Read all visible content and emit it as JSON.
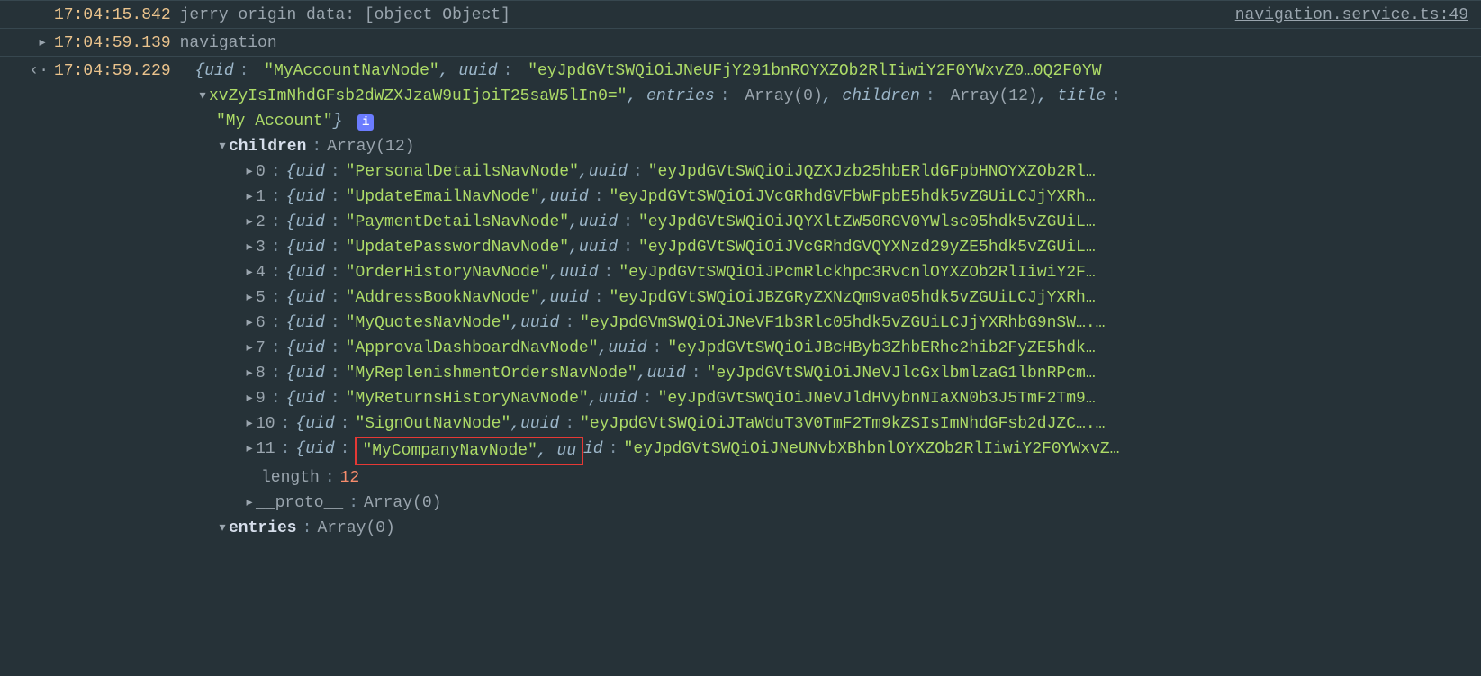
{
  "source_link": "navigation.service.ts:49",
  "log0": {
    "time": "17:04:15.842",
    "text": "jerry origin data:  [object Object]"
  },
  "log1": {
    "time": "17:04:59.139",
    "text": "navigation"
  },
  "log2": {
    "time": "17:04:59.229"
  },
  "obj": {
    "uid_key": "uid",
    "uid_val": "\"MyAccountNavNode\"",
    "uuid_key": "uuid",
    "uuid_val": "\"eyJpdGVtSWQiOiJNeUFjY291bnROYXZOb2RlIiwiY2F0YWxvZ0…0Q2F0YW",
    "uuid_val2": "xvZyIsImNhdGFsb2dWZXJzaW9uIjoiT25saW5lIn0=\"",
    "entries_key": "entries",
    "entries_val": "Array(0)",
    "children_key": "children",
    "children_val": "Array(12)",
    "title_key": "title",
    "title_val": "\"My Account\""
  },
  "children_header": {
    "label": "children",
    "type": "Array(12)"
  },
  "children": [
    {
      "idx": "0",
      "uid": "\"PersonalDetailsNavNode\"",
      "uuid": "\"eyJpdGVtSWQiOiJQZXJzb25hbERldGFpbHNOYXZOb2Rl…"
    },
    {
      "idx": "1",
      "uid": "\"UpdateEmailNavNode\"",
      "uuid": "\"eyJpdGVtSWQiOiJVcGRhdGVFbWFpbE5hdk5vZGUiLCJjYXRh…"
    },
    {
      "idx": "2",
      "uid": "\"PaymentDetailsNavNode\"",
      "uuid": "\"eyJpdGVtSWQiOiJQYXltZW50RGV0YWlsc05hdk5vZGUiL…"
    },
    {
      "idx": "3",
      "uid": "\"UpdatePasswordNavNode\"",
      "uuid": "\"eyJpdGVtSWQiOiJVcGRhdGVQYXNzd29yZE5hdk5vZGUiL…"
    },
    {
      "idx": "4",
      "uid": "\"OrderHistoryNavNode\"",
      "uuid": "\"eyJpdGVtSWQiOiJPcmRlckhpc3RvcnlOYXZOb2RlIiwiY2F…"
    },
    {
      "idx": "5",
      "uid": "\"AddressBookNavNode\"",
      "uuid": "\"eyJpdGVtSWQiOiJBZGRyZXNzQm9va05hdk5vZGUiLCJjYXRh…"
    },
    {
      "idx": "6",
      "uid": "\"MyQuotesNavNode\"",
      "uuid": "\"eyJpdGVmSWQiOiJNeVF1b3Rlc05hdk5vZGUiLCJjYXRhbG9nSW….…"
    },
    {
      "idx": "7",
      "uid": "\"ApprovalDashboardNavNode\"",
      "uuid": "\"eyJpdGVtSWQiOiJBcHByb3ZhbERhc2hib2FyZE5hdk…"
    },
    {
      "idx": "8",
      "uid": "\"MyReplenishmentOrdersNavNode\"",
      "uuid": "\"eyJpdGVtSWQiOiJNeVJlcGxlbmlzaG1lbnRPcm…"
    },
    {
      "idx": "9",
      "uid": "\"MyReturnsHistoryNavNode\"",
      "uuid": "\"eyJpdGVtSWQiOiJNeVJldHVybnNIaXN0b3J5TmF2Tm9…"
    },
    {
      "idx": "10",
      "uid": "\"SignOutNavNode\"",
      "uuid": "\"eyJpdGVtSWQiOiJTaWduT3V0TmF2Tm9kZSIsImNhdGFsb2dJZC….…"
    },
    {
      "idx": "11",
      "uid": "\"MyCompanyNavNode\"",
      "uuid": "\"eyJpdGVtSWQiOiJNeUNvbXBhbnlOYXZOb2RlIiwiY2F0YWxvZ…"
    }
  ],
  "length": {
    "label": "length",
    "val": "12"
  },
  "proto": {
    "label": "__proto__",
    "val": "Array(0)"
  },
  "entries": {
    "label": "entries",
    "val": "Array(0)"
  }
}
